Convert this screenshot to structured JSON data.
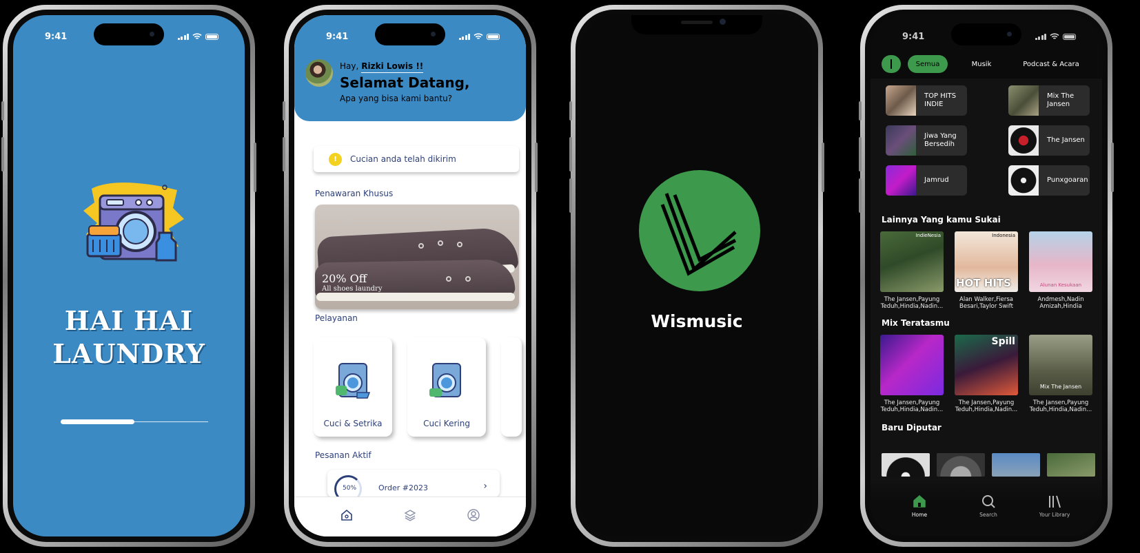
{
  "status_time": "9:41",
  "laundry_splash": {
    "title_line1": "HAI HAI",
    "title_line2": "LAUNDRY",
    "progress": 0.5
  },
  "laundry_home": {
    "greeting": "Hay,",
    "user_name": "Rizki Lowis !!",
    "welcome": "Selamat Datang,",
    "subtitle": "Apa yang bisa kami bantu?",
    "notice": "Cucian anda telah dikirim",
    "special_offer_title": "Penawaran Khusus",
    "promo_title": "20% Off",
    "promo_subtitle": "All shoes laundry",
    "services_title": "Pelayanan",
    "services": [
      {
        "label": "Cuci & Setrika"
      },
      {
        "label": "Cuci Kering"
      }
    ],
    "active_orders_title": "Pesanan Aktif",
    "order_progress": "50%",
    "order_label": "Order #2023"
  },
  "wismusic_splash": {
    "app_name": "Wismusic"
  },
  "wismusic_home": {
    "filters": [
      "Semua",
      "Musik",
      "Podcast & Acara"
    ],
    "quick_picks": [
      {
        "label": "TOP HITS INDIE"
      },
      {
        "label": "Mix The Jansen"
      },
      {
        "label": "Jiwa Yang Bersedih"
      },
      {
        "label": "The Jansen"
      },
      {
        "label": "Jamrud"
      },
      {
        "label": "Punxgoaran"
      }
    ],
    "section1_title": "Lainnya Yang kamu Sukai",
    "section1": [
      {
        "cover_text": "IndieNesia",
        "caption": "The Jansen,Payung Teduh,Hindia,Nadin..."
      },
      {
        "cover_text": "Indonesia",
        "cover_big": "HOT HITS",
        "caption": "Alan Walker,Fiersa Besari,Taylor Swift"
      },
      {
        "cover_text": "Alunan Kesukaan",
        "caption": "Andmesh,Nadin Amizah,Hindia"
      }
    ],
    "section2_title": "Mix Teratasmu",
    "section2": [
      {
        "cover_text": "",
        "caption": "The Jansen,Payung Teduh,Hindia,Nadin..."
      },
      {
        "cover_text": "Spill",
        "caption": "The Jansen,Payung Teduh,Hindia,Nadin..."
      },
      {
        "cover_text": "Mix The Jansen",
        "caption": "The Jansen,Payung Teduh,Hindia,Nadin..."
      }
    ],
    "section3_title": "Baru Diputar",
    "nav": [
      {
        "label": "Home"
      },
      {
        "label": "Search"
      },
      {
        "label": "Your Library"
      }
    ],
    "colors": {
      "accent": "#3d9a4c",
      "background": "#121212"
    }
  }
}
